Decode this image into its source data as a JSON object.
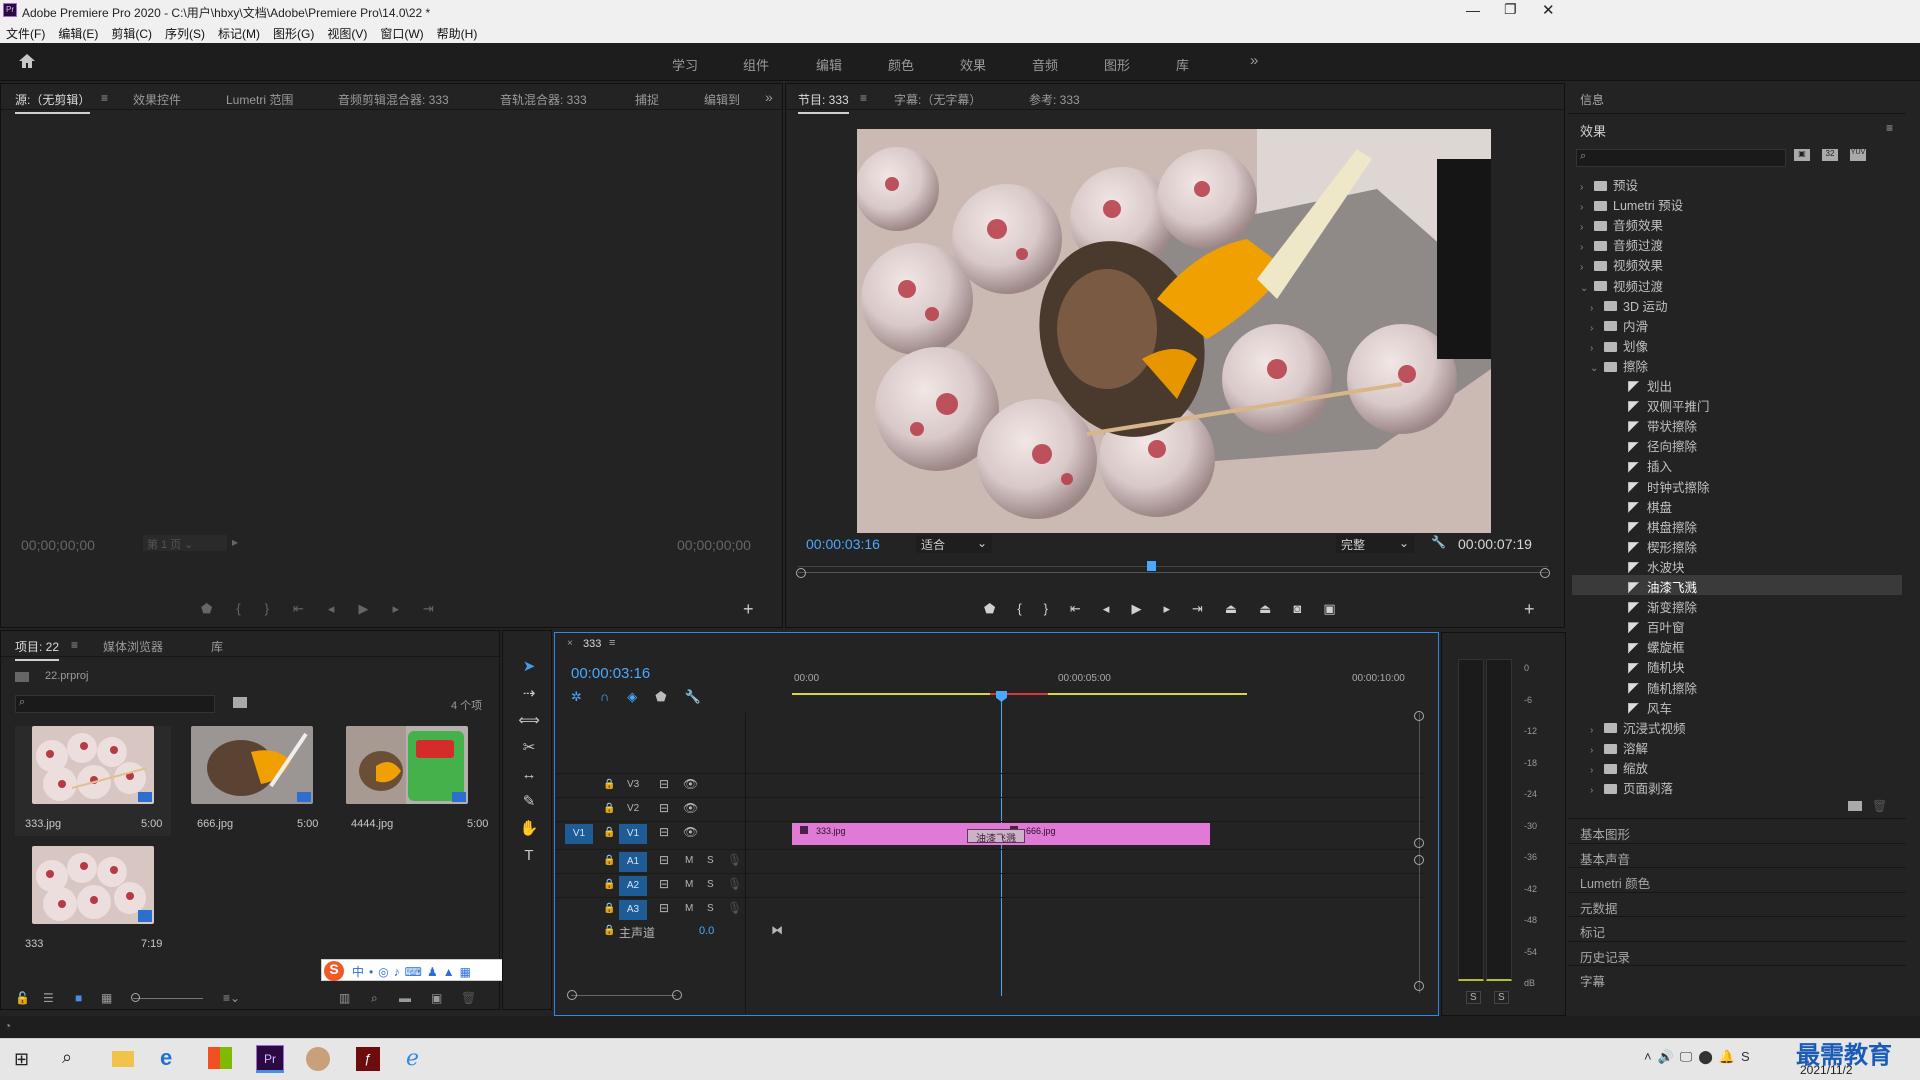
{
  "window": {
    "title": "Adobe Premiere Pro 2020 - C:\\用户\\hbxy\\文档\\Adobe\\Premiere Pro\\14.0\\22 *",
    "app_icon": "Pr"
  },
  "menu": [
    "文件(F)",
    "编辑(E)",
    "剪辑(C)",
    "序列(S)",
    "标记(M)",
    "图形(G)",
    "视图(V)",
    "窗口(W)",
    "帮助(H)"
  ],
  "workspaces": [
    "学习",
    "组件",
    "编辑",
    "颜色",
    "效果",
    "音频",
    "图形",
    "库"
  ],
  "source_panel": {
    "tabs": [
      "源:（无剪辑）",
      "效果控件",
      "Lumetri 范围",
      "音频剪辑混合器: 333",
      "音轨混合器: 333",
      "捕捉",
      "编辑到"
    ],
    "timecode_left": "00;00;00;00",
    "timecode_right": "00;00;00;00",
    "page_select": "第 1 页"
  },
  "program_panel": {
    "tabs": [
      "节目: 333",
      "字幕:（无字幕）",
      "参考: 333"
    ],
    "timecode": "00:00:03:16",
    "fit": "适合",
    "quality": "完整",
    "duration": "00:00:07:19",
    "playhead_fraction": 0.47
  },
  "project_panel": {
    "tabs": [
      "项目: 22",
      "媒体浏览器",
      "库"
    ],
    "project_file": "22.prproj",
    "item_count": "4 个项",
    "items": [
      {
        "name": "333.jpg",
        "duration": "5:00"
      },
      {
        "name": "666.jpg",
        "duration": "5:00"
      },
      {
        "name": "4444.jpg",
        "duration": "5:00"
      },
      {
        "name": "333",
        "duration": "7:19"
      }
    ]
  },
  "timeline": {
    "sequence": "333",
    "timecode": "00:00:03:16",
    "ruler": [
      "00:00",
      "00:00:05:00",
      "00:00:10:00"
    ],
    "video_tracks": [
      "V3",
      "V2",
      "V1"
    ],
    "audio_tracks": [
      "A1",
      "A2",
      "A3"
    ],
    "source_patch_v": "V1",
    "master": "主声道",
    "master_value": "0.0",
    "clips": [
      {
        "label": "333.jpg"
      },
      {
        "label": "666.jpg"
      }
    ],
    "transition": "油漆飞溅",
    "mute": "M",
    "solo": "S"
  },
  "meter": {
    "scale": [
      "0",
      "-6",
      "-12",
      "-18",
      "-24",
      "-30",
      "-36",
      "-42",
      "-48",
      "-54",
      "dB"
    ],
    "solo_labels": [
      "S",
      "S"
    ]
  },
  "right_panel": {
    "info_tab": "信息",
    "effects_title": "效果",
    "tree": [
      {
        "label": "预设",
        "level": 0,
        "type": "folder",
        "open": false
      },
      {
        "label": "Lumetri 预设",
        "level": 0,
        "type": "folder",
        "open": false
      },
      {
        "label": "音频效果",
        "level": 0,
        "type": "folder",
        "open": false
      },
      {
        "label": "音频过渡",
        "level": 0,
        "type": "folder",
        "open": false
      },
      {
        "label": "视频效果",
        "level": 0,
        "type": "folder",
        "open": false
      },
      {
        "label": "视频过渡",
        "level": 0,
        "type": "folder",
        "open": true
      },
      {
        "label": "3D 运动",
        "level": 1,
        "type": "folder",
        "open": false
      },
      {
        "label": "内滑",
        "level": 1,
        "type": "folder",
        "open": false
      },
      {
        "label": "划像",
        "level": 1,
        "type": "folder",
        "open": false
      },
      {
        "label": "擦除",
        "level": 1,
        "type": "folder",
        "open": true
      },
      {
        "label": "划出",
        "level": 2,
        "type": "fx"
      },
      {
        "label": "双侧平推门",
        "level": 2,
        "type": "fx"
      },
      {
        "label": "带状擦除",
        "level": 2,
        "type": "fx"
      },
      {
        "label": "径向擦除",
        "level": 2,
        "type": "fx"
      },
      {
        "label": "插入",
        "level": 2,
        "type": "fx"
      },
      {
        "label": "时钟式擦除",
        "level": 2,
        "type": "fx"
      },
      {
        "label": "棋盘",
        "level": 2,
        "type": "fx"
      },
      {
        "label": "棋盘擦除",
        "level": 2,
        "type": "fx"
      },
      {
        "label": "楔形擦除",
        "level": 2,
        "type": "fx"
      },
      {
        "label": "水波块",
        "level": 2,
        "type": "fx"
      },
      {
        "label": "油漆飞溅",
        "level": 2,
        "type": "fx",
        "selected": true
      },
      {
        "label": "渐变擦除",
        "level": 2,
        "type": "fx"
      },
      {
        "label": "百叶窗",
        "level": 2,
        "type": "fx"
      },
      {
        "label": "螺旋框",
        "level": 2,
        "type": "fx"
      },
      {
        "label": "随机块",
        "level": 2,
        "type": "fx"
      },
      {
        "label": "随机擦除",
        "level": 2,
        "type": "fx"
      },
      {
        "label": "风车",
        "level": 2,
        "type": "fx"
      },
      {
        "label": "沉浸式视频",
        "level": 1,
        "type": "folder",
        "open": false
      },
      {
        "label": "溶解",
        "level": 1,
        "type": "folder",
        "open": false
      },
      {
        "label": "缩放",
        "level": 1,
        "type": "folder",
        "open": false
      },
      {
        "label": "页面剥落",
        "level": 1,
        "type": "folder",
        "open": false
      }
    ],
    "sections": [
      "基本图形",
      "基本声音",
      "Lumetri 颜色",
      "元数据",
      "标记",
      "历史记录",
      "字幕"
    ]
  },
  "taskbar": {
    "date": "2021/11/2",
    "watermark": "最需教育"
  },
  "colors": {
    "accent": "#2d8ceb",
    "clip": "#e07ad6",
    "timecode": "#4aa8ff",
    "workarea": "#d7d73a"
  }
}
